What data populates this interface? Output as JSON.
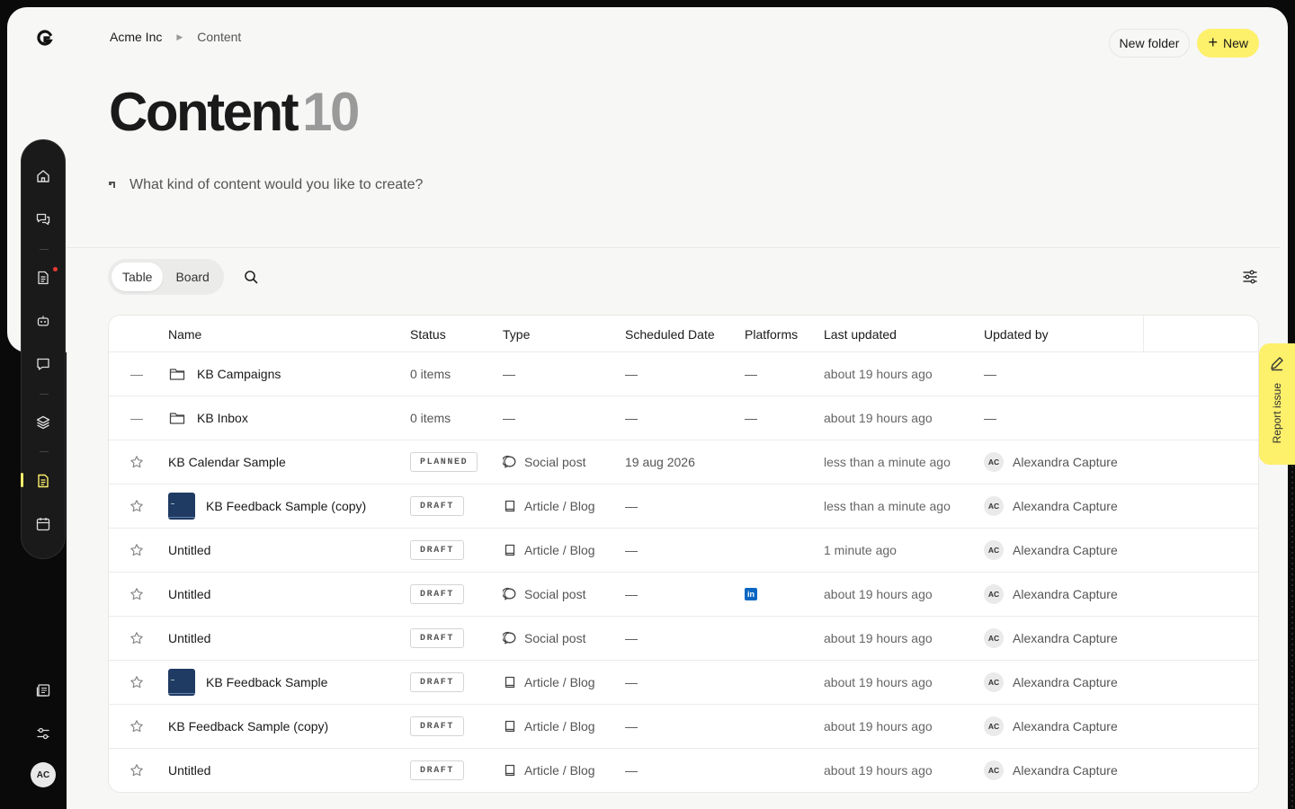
{
  "breadcrumb": {
    "org": "Acme Inc",
    "current": "Content"
  },
  "actions": {
    "new_folder": "New folder",
    "new": "New"
  },
  "page": {
    "title": "Content",
    "count": "10"
  },
  "prompt": {
    "placeholder": "What kind of content would you like to create?"
  },
  "views": {
    "table": "Table",
    "board": "Board",
    "active": "Table"
  },
  "columns": {
    "name": "Name",
    "status": "Status",
    "type": "Type",
    "scheduled": "Scheduled Date",
    "platforms": "Platforms",
    "updated": "Last updated",
    "updated_by": "Updated by"
  },
  "rows": [
    {
      "kind": "folder",
      "name": "KB Campaigns",
      "status": "0 items",
      "type": "—",
      "scheduled": "—",
      "platforms": "—",
      "updated": "about 19 hours ago",
      "updated_by": "—"
    },
    {
      "kind": "folder",
      "name": "KB Inbox",
      "status": "0 items",
      "type": "—",
      "scheduled": "—",
      "platforms": "—",
      "updated": "about 19 hours ago",
      "updated_by": "—"
    },
    {
      "kind": "item",
      "name": "KB Calendar Sample",
      "status": "PLANNED",
      "type": "Social post",
      "type_icon": "chat-bubble-icon",
      "scheduled": "19 aug 2026",
      "platforms": "",
      "updated": "less than a minute ago",
      "initials": "AC",
      "updated_by": "Alexandra Capture"
    },
    {
      "kind": "item",
      "thumb": true,
      "name": "KB Feedback Sample (copy)",
      "status": "DRAFT",
      "type": "Article / Blog",
      "type_icon": "book-icon",
      "scheduled": "—",
      "platforms": "",
      "updated": "less than a minute ago",
      "initials": "AC",
      "updated_by": "Alexandra Capture"
    },
    {
      "kind": "item",
      "name": "Untitled",
      "status": "DRAFT",
      "type": "Article / Blog",
      "type_icon": "book-icon",
      "scheduled": "—",
      "platforms": "",
      "updated": "1 minute ago",
      "initials": "AC",
      "updated_by": "Alexandra Capture"
    },
    {
      "kind": "item",
      "name": "Untitled",
      "status": "DRAFT",
      "type": "Social post",
      "type_icon": "chat-bubble-icon",
      "scheduled": "—",
      "platforms": "linkedin",
      "updated": "about 19 hours ago",
      "initials": "AC",
      "updated_by": "Alexandra Capture"
    },
    {
      "kind": "item",
      "name": "Untitled",
      "status": "DRAFT",
      "type": "Social post",
      "type_icon": "chat-bubble-icon",
      "scheduled": "—",
      "platforms": "",
      "updated": "about 19 hours ago",
      "initials": "AC",
      "updated_by": "Alexandra Capture"
    },
    {
      "kind": "item",
      "thumb": true,
      "name": "KB Feedback Sample",
      "status": "DRAFT",
      "type": "Article / Blog",
      "type_icon": "book-icon",
      "scheduled": "—",
      "platforms": "",
      "updated": "about 19 hours ago",
      "initials": "AC",
      "updated_by": "Alexandra Capture"
    },
    {
      "kind": "item",
      "name": "KB Feedback Sample (copy)",
      "status": "DRAFT",
      "type": "Article / Blog",
      "type_icon": "book-icon",
      "scheduled": "—",
      "platforms": "",
      "updated": "about 19 hours ago",
      "initials": "AC",
      "updated_by": "Alexandra Capture"
    },
    {
      "kind": "item",
      "name": "Untitled",
      "status": "DRAFT",
      "type": "Article / Blog",
      "type_icon": "book-icon",
      "scheduled": "—",
      "platforms": "",
      "updated": "about 19 hours ago",
      "initials": "AC",
      "updated_by": "Alexandra Capture"
    }
  ],
  "sidebar": {
    "items": [
      "home-icon",
      "chats-icon",
      "document-icon",
      "robot-icon",
      "message-icon",
      "layers-icon",
      "content-icon",
      "calendar-icon"
    ],
    "active": "content-icon"
  },
  "user": {
    "initials": "AC"
  },
  "report": {
    "label": "Report issue"
  },
  "colors": {
    "accent": "#fdf06b",
    "sidebar": "#1a1a1a",
    "linkedin": "#0a66c2",
    "thumb": "#1f3a63"
  }
}
